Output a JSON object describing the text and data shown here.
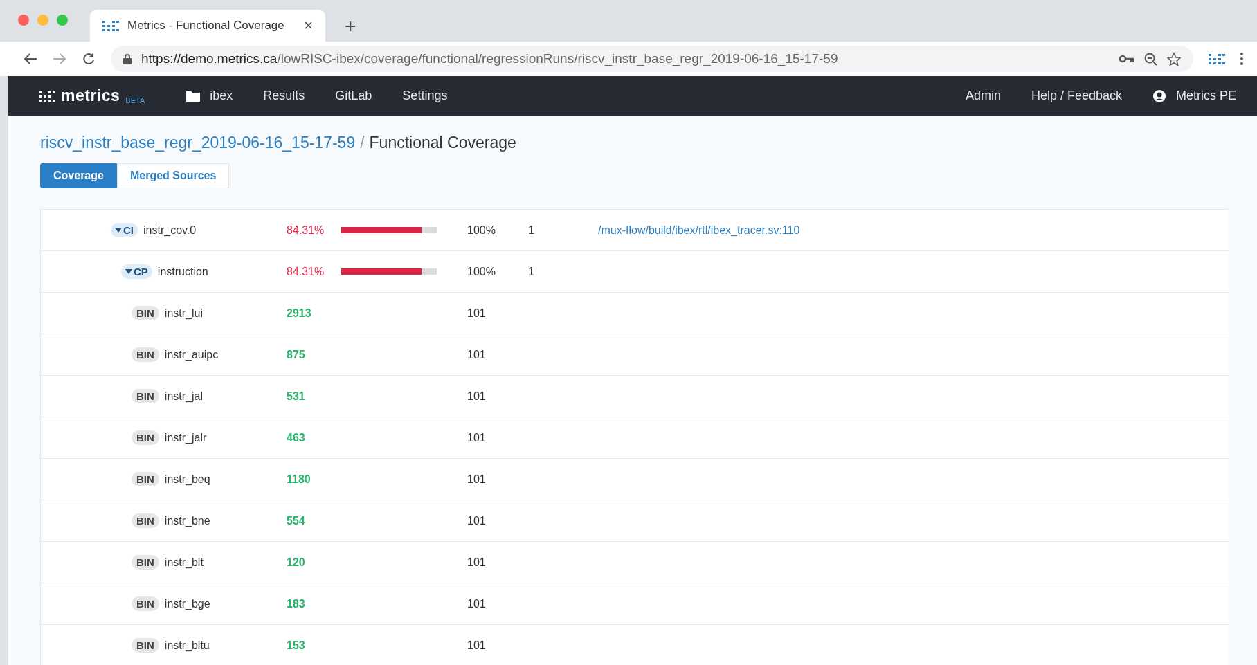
{
  "browser": {
    "tab": {
      "title": "Metrics - Functional Coverage",
      "close": "×"
    },
    "new_tab": "+",
    "url": {
      "host": "https://demo.metrics.ca",
      "path": "/lowRISC-ibex/coverage/functional/regressionRuns/riscv_instr_base_regr_2019-06-16_15-17-59"
    }
  },
  "navbar": {
    "brand": "metrics",
    "brand_tag": "BETA",
    "project": "ibex",
    "links": [
      "Results",
      "GitLab",
      "Settings"
    ],
    "right_links": [
      "Admin",
      "Help / Feedback"
    ],
    "user": "Metrics PE"
  },
  "breadcrumb": {
    "parent": "riscv_instr_base_regr_2019-06-16_15-17-59",
    "separator": "/",
    "current": "Functional Coverage"
  },
  "tabs": [
    {
      "label": "Coverage",
      "selected": true
    },
    {
      "label": "Merged Sources",
      "selected": false
    }
  ],
  "tree": [
    {
      "kind": "group",
      "type": "CI",
      "name": "instr_cov.0",
      "expanded": true,
      "percent": "84.31%",
      "level": 0.8431,
      "goal": "100%",
      "weight": "1",
      "source": "/mux-flow/build/ibex/rtl/ibex_tracer.sv:110",
      "children": [
        {
          "kind": "group",
          "type": "CP",
          "name": "instruction",
          "expanded": true,
          "percent": "84.31%",
          "level": 0.8431,
          "goal": "100%",
          "weight": "1",
          "children": [
            {
              "kind": "bin",
              "type": "BIN",
              "name": "instr_lui",
              "hits": "2913",
              "goal": "101"
            },
            {
              "kind": "bin",
              "type": "BIN",
              "name": "instr_auipc",
              "hits": "875",
              "goal": "101"
            },
            {
              "kind": "bin",
              "type": "BIN",
              "name": "instr_jal",
              "hits": "531",
              "goal": "101"
            },
            {
              "kind": "bin",
              "type": "BIN",
              "name": "instr_jalr",
              "hits": "463",
              "goal": "101"
            },
            {
              "kind": "bin",
              "type": "BIN",
              "name": "instr_beq",
              "hits": "1180",
              "goal": "101"
            },
            {
              "kind": "bin",
              "type": "BIN",
              "name": "instr_bne",
              "hits": "554",
              "goal": "101"
            },
            {
              "kind": "bin",
              "type": "BIN",
              "name": "instr_blt",
              "hits": "120",
              "goal": "101"
            },
            {
              "kind": "bin",
              "type": "BIN",
              "name": "instr_bge",
              "hits": "183",
              "goal": "101"
            },
            {
              "kind": "bin",
              "type": "BIN",
              "name": "instr_bltu",
              "hits": "153",
              "goal": "101"
            }
          ]
        }
      ]
    }
  ]
}
